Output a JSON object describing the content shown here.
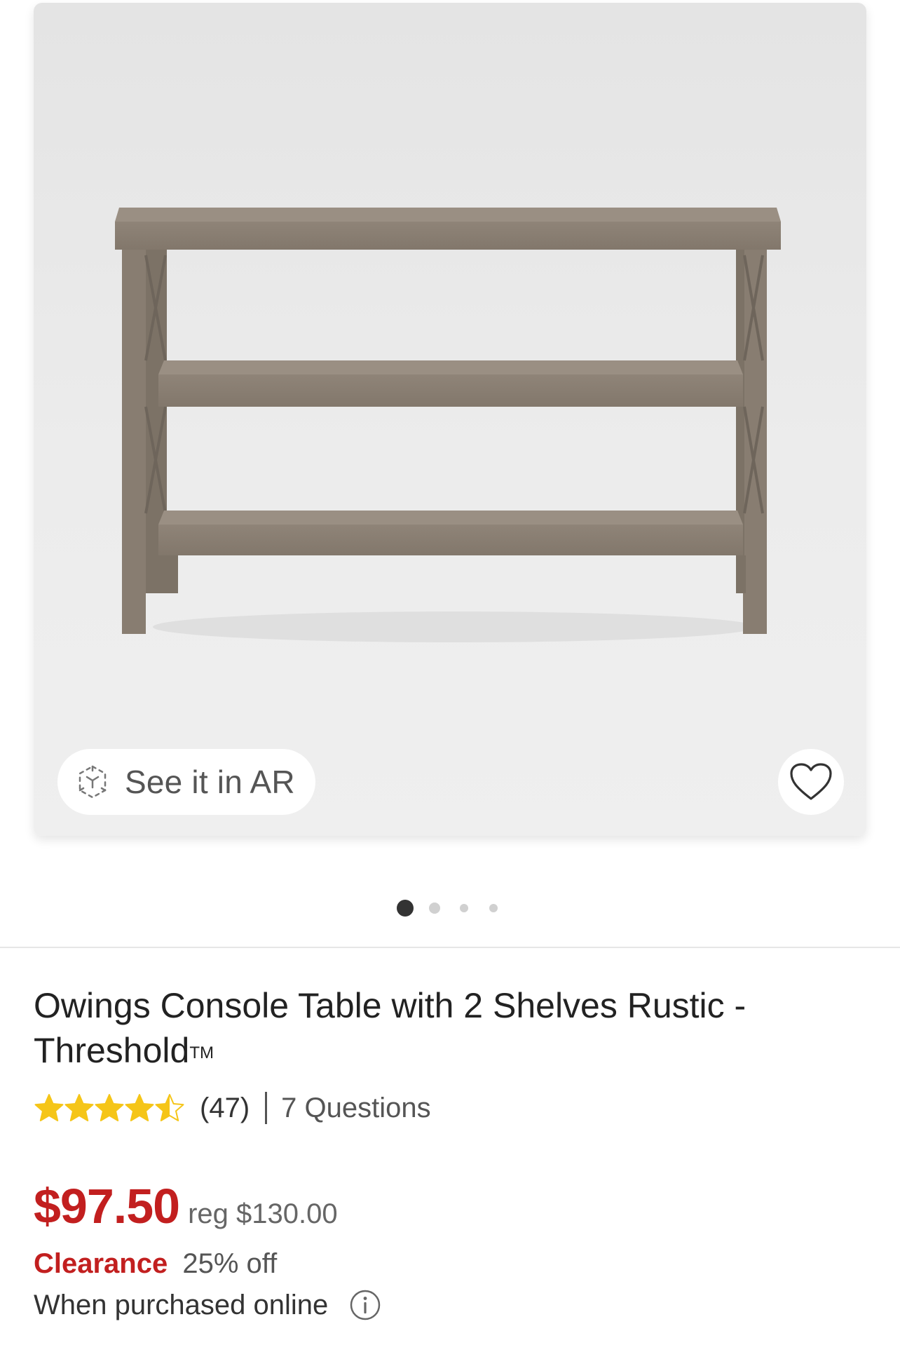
{
  "image_card": {
    "ar_button_label": "See it in AR",
    "ar_icon": "ar-cube-icon",
    "favorite_icon": "heart-outline-icon"
  },
  "carousel": {
    "total_dots": 4,
    "active_index": 0
  },
  "product": {
    "title": "Owings Console Table with 2 Shelves Rustic - Threshold",
    "title_trademark": "TM",
    "rating": {
      "value": 4.5,
      "max": 5,
      "count_text": "(47)",
      "star_color": "#f5c518"
    },
    "questions_text": "7 Questions",
    "price": "$97.50",
    "reg_price": "reg $130.00",
    "clearance_label": "Clearance",
    "discount_text": "25% off",
    "online_text": "When purchased online",
    "info_icon": "info-icon"
  },
  "colors": {
    "price_red": "#c21f1f",
    "active_dot": "#333333",
    "inactive_dot": "#d0d0d0",
    "divider": "#e6e6e6"
  }
}
